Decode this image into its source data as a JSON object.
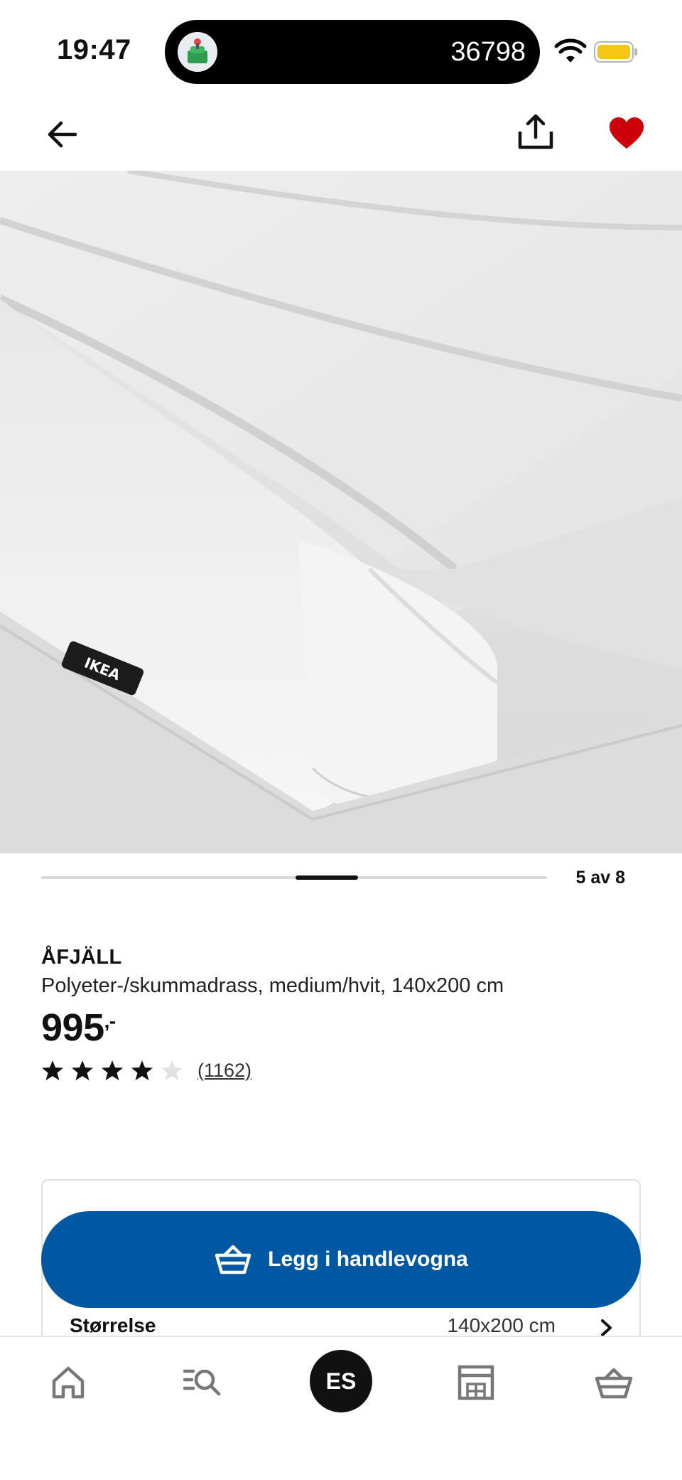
{
  "status_bar": {
    "time": "19:47",
    "island_count": "36798",
    "wifi_icon": "wifi-icon",
    "battery_icon": "battery-icon",
    "battery_color": "#f5c518"
  },
  "app_bar": {
    "back_icon": "arrow-left-icon",
    "share_icon": "share-icon",
    "favorite_icon": "heart-icon",
    "favorite_color": "#cc0008"
  },
  "gallery": {
    "counter": "5 av 8",
    "current": 5,
    "total": 8
  },
  "product": {
    "name": "ÅFJÄLL",
    "description": "Polyeter-/skummadrass, medium/hvit, 140x200 cm",
    "price": "995",
    "price_suffix": ",-",
    "rating": 4,
    "rating_max": 5,
    "review_count": "(1162)"
  },
  "purchase": {
    "add_to_cart_label": "Legg i handlevogna",
    "button_color": "#0058a3",
    "size_label": "Størrelse",
    "size_value": "140x200 cm"
  },
  "bottom_nav": {
    "items": [
      {
        "icon": "home-icon"
      },
      {
        "icon": "search-list-icon"
      },
      {
        "label": "ES"
      },
      {
        "icon": "store-icon"
      },
      {
        "icon": "basket-icon"
      }
    ]
  }
}
